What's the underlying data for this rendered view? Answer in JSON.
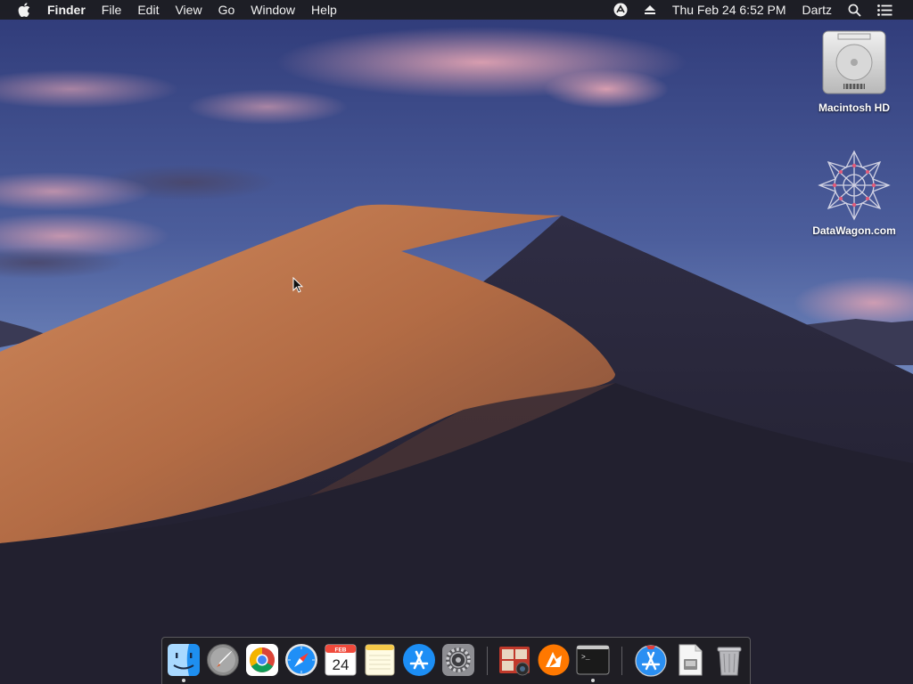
{
  "menubar": {
    "app_name": "Finder",
    "menus": [
      "File",
      "Edit",
      "View",
      "Go",
      "Window",
      "Help"
    ],
    "clock": "Thu Feb 24  6:52 PM",
    "user": "Dartz",
    "status_icons": [
      "accessibility-icon",
      "eject-icon",
      "spotlight-search-icon",
      "notification-center-icon"
    ]
  },
  "desktop": {
    "icons": [
      {
        "label": "Macintosh HD",
        "icon": "hard-drive-icon"
      },
      {
        "label": "DataWagon.com",
        "icon": "network-share-icon"
      }
    ]
  },
  "dock": {
    "calendar": {
      "month": "FEB",
      "day": "24"
    },
    "terminal_prompt": ">_",
    "items": [
      {
        "name": "finder",
        "icon": "finder-icon",
        "running": true
      },
      {
        "name": "launchpad",
        "icon": "launchpad-icon",
        "running": false
      },
      {
        "name": "chrome",
        "icon": "chrome-icon",
        "running": false
      },
      {
        "name": "safari",
        "icon": "safari-icon",
        "running": false
      },
      {
        "name": "calendar",
        "icon": "calendar-icon",
        "running": false
      },
      {
        "name": "notes",
        "icon": "notes-icon",
        "running": false
      },
      {
        "name": "app-store",
        "icon": "app-store-icon",
        "running": false
      },
      {
        "name": "system-preferences",
        "icon": "system-preferences-icon",
        "running": false
      },
      {
        "name": "photo-booth",
        "icon": "photo-booth-icon",
        "running": false
      },
      {
        "name": "avast",
        "icon": "avast-icon",
        "running": false
      },
      {
        "name": "terminal",
        "icon": "terminal-icon",
        "running": true
      },
      {
        "name": "app-store-downloads",
        "icon": "app-store-downloads-icon",
        "running": false
      },
      {
        "name": "document",
        "icon": "document-icon",
        "running": false
      },
      {
        "name": "trash",
        "icon": "trash-icon",
        "running": false
      }
    ]
  },
  "colors": {
    "menubar_bg": "#1c1c1e",
    "dock_bg": "#1e1e22",
    "dune_light": "#c47d54",
    "dune_dark": "#2a2838",
    "sky_top": "#3f4e8a",
    "sky_bottom": "#8aa0d0"
  }
}
